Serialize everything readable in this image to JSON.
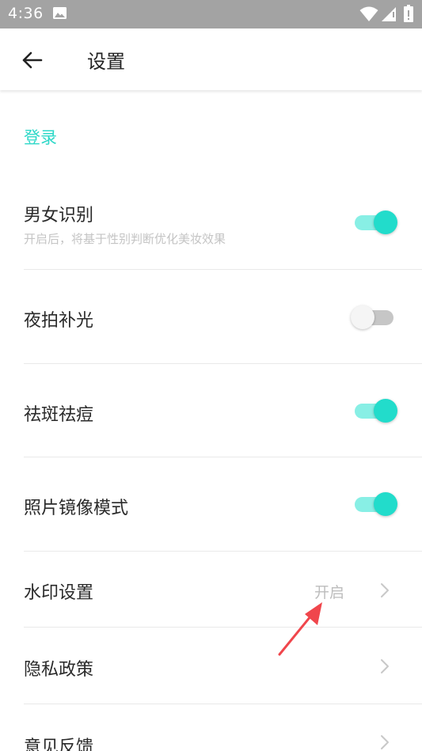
{
  "status_bar": {
    "time": "4:36",
    "icons": [
      "image-icon",
      "wifi-icon",
      "signal-icon",
      "battery-icon"
    ]
  },
  "toolbar": {
    "title": "设置",
    "back_icon": "arrow-left-icon"
  },
  "section": {
    "title": "登录"
  },
  "settings": {
    "gender": {
      "label": "男女识别",
      "sublabel": "开启后，将基于性别判断优化美妆效果",
      "state": "on"
    },
    "night_flash": {
      "label": "夜拍补光",
      "state": "off"
    },
    "blemish": {
      "label": "祛斑祛痘",
      "state": "on"
    },
    "mirror": {
      "label": "照片镜像模式",
      "state": "on"
    },
    "watermark": {
      "label": "水印设置",
      "value": "开启"
    },
    "privacy": {
      "label": "隐私政策"
    },
    "feedback": {
      "label": "意见反馈"
    }
  },
  "colors": {
    "accent": "#2ed8c8",
    "toggle_track_on": "#88efe5",
    "toggle_thumb_on": "#22dccb",
    "annotation_arrow": "#f0464c"
  }
}
